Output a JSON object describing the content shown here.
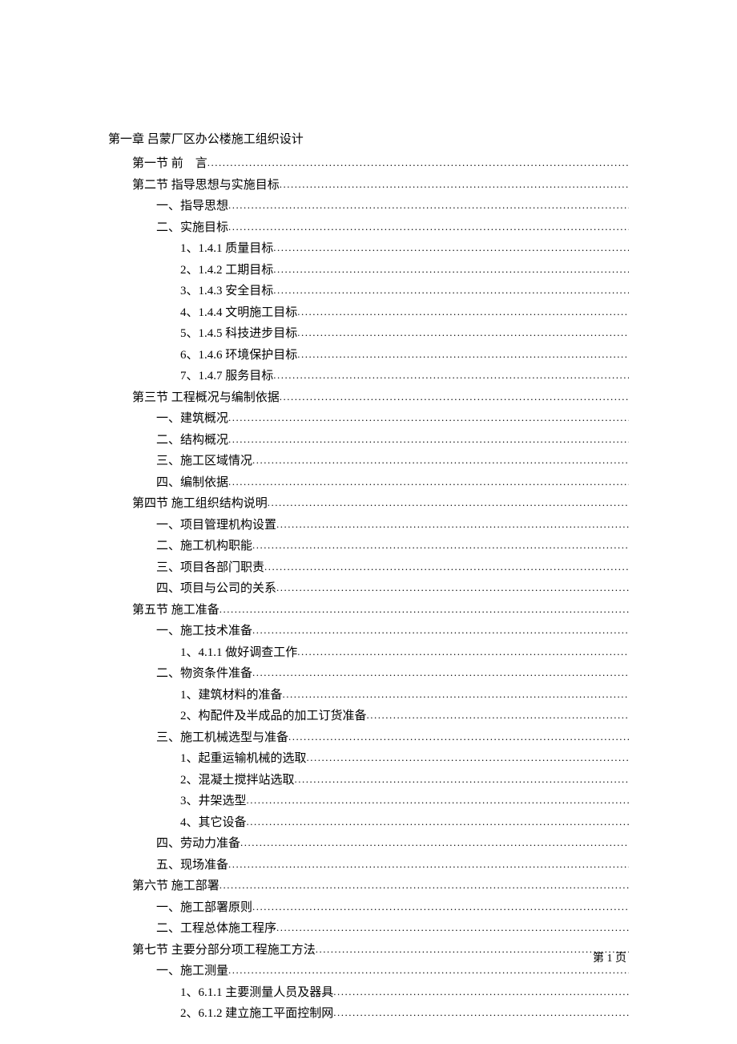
{
  "chapter": "第一章 吕蒙厂区办公楼施工组织设计",
  "toc": [
    {
      "level": 1,
      "prefix": "第一节 ",
      "label": "前　言"
    },
    {
      "level": 1,
      "prefix": "第二节 ",
      "label": "指导思想与实施目标"
    },
    {
      "level": 2,
      "prefix": "一、",
      "label": "指导思想"
    },
    {
      "level": 2,
      "prefix": "二、",
      "label": "实施目标"
    },
    {
      "level": 3,
      "prefix": "1、",
      "label": "1.4.1 质量目标"
    },
    {
      "level": 3,
      "prefix": "2、",
      "label": "1.4.2 工期目标"
    },
    {
      "level": 3,
      "prefix": "3、",
      "label": "1.4.3 安全目标"
    },
    {
      "level": 3,
      "prefix": "4、",
      "label": "1.4.4 文明施工目标"
    },
    {
      "level": 3,
      "prefix": "5、",
      "label": "1.4.5 科技进步目标"
    },
    {
      "level": 3,
      "prefix": "6、",
      "label": "1.4.6 环境保护目标"
    },
    {
      "level": 3,
      "prefix": "7、",
      "label": "1.4.7 服务目标"
    },
    {
      "level": 1,
      "prefix": "第三节 ",
      "label": "工程概况与编制依据"
    },
    {
      "level": 2,
      "prefix": "一、",
      "label": "建筑概况"
    },
    {
      "level": 2,
      "prefix": "二、",
      "label": "结构概况"
    },
    {
      "level": 2,
      "prefix": "三、",
      "label": "施工区域情况"
    },
    {
      "level": 2,
      "prefix": "四、",
      "label": "编制依据"
    },
    {
      "level": 1,
      "prefix": "第四节 ",
      "label": "施工组织结构说明"
    },
    {
      "level": 2,
      "prefix": "一、",
      "label": "项目管理机构设置"
    },
    {
      "level": 2,
      "prefix": "二、",
      "label": "施工机构职能"
    },
    {
      "level": 2,
      "prefix": "三、",
      "label": "项目各部门职责"
    },
    {
      "level": 2,
      "prefix": "四、",
      "label": "项目与公司的关系"
    },
    {
      "level": 1,
      "prefix": "第五节 ",
      "label": "施工准备"
    },
    {
      "level": 2,
      "prefix": "一、",
      "label": "施工技术准备"
    },
    {
      "level": 3,
      "prefix": "1、",
      "label": "4.1.1 做好调查工作"
    },
    {
      "level": 2,
      "prefix": "二、",
      "label": "物资条件准备"
    },
    {
      "level": 3,
      "prefix": "1、",
      "label": "建筑材料的准备"
    },
    {
      "level": 3,
      "prefix": "2、",
      "label": "构配件及半成品的加工订货准备"
    },
    {
      "level": 2,
      "prefix": "三、",
      "label": "施工机械选型与准备"
    },
    {
      "level": 3,
      "prefix": "1、",
      "label": "起重运输机械的选取"
    },
    {
      "level": 3,
      "prefix": "2、",
      "label": "混凝土搅拌站选取"
    },
    {
      "level": 3,
      "prefix": "3、",
      "label": "井架选型"
    },
    {
      "level": 3,
      "prefix": "4、",
      "label": "其它设备"
    },
    {
      "level": 2,
      "prefix": "四、",
      "label": "劳动力准备"
    },
    {
      "level": 2,
      "prefix": "五、",
      "label": "现场准备"
    },
    {
      "level": 1,
      "prefix": "第六节 ",
      "label": "施工部署"
    },
    {
      "level": 2,
      "prefix": "一、",
      "label": "施工部署原则"
    },
    {
      "level": 2,
      "prefix": "二、",
      "label": "工程总体施工程序"
    },
    {
      "level": 1,
      "prefix": "第七节 ",
      "label": "主要分部分项工程施工方法"
    },
    {
      "level": 2,
      "prefix": "一、",
      "label": "施工测量"
    },
    {
      "level": 3,
      "prefix": "1、",
      "label": "6.1.1 主要测量人员及器具"
    },
    {
      "level": 3,
      "prefix": "2、",
      "label": "6.1.2 建立施工平面控制网"
    }
  ],
  "pageFooter": "第 1 页"
}
